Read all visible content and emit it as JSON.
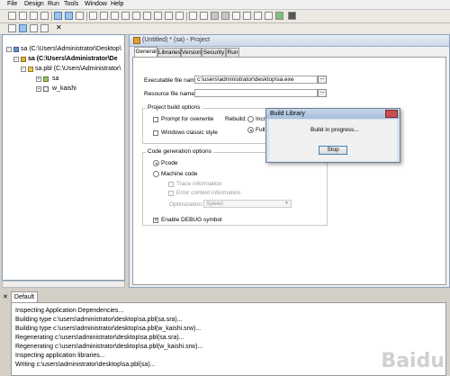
{
  "menu": [
    "File",
    "Design",
    "Run",
    "Tools",
    "Window",
    "Help"
  ],
  "tree": {
    "workspace": "sa (C:\\Users\\Administrator\\Desktop\\",
    "target": "sa (C:\\Users\\Administrator\\De",
    "library": "sa.pbl (C:\\Users\\Administrator\\",
    "item1": "sa",
    "item2": "w_kaishi"
  },
  "project": {
    "title": "(Untitled) * (sa) - Project",
    "tabs": [
      "General",
      "Libraries",
      "Version",
      "Security",
      "Run"
    ],
    "exe_label": "Executable file name:",
    "exe_value": "c:\\users\\administrator\\desktop\\sa.exe",
    "res_label": "Resource file name:",
    "res_value": "",
    "dots": "...",
    "build_options_title": "Project build options",
    "prompt_overwrite": "Prompt for overwrite",
    "rebuild_label": "Rebuild:",
    "rebuild_incr": "Incre",
    "rebuild_full": "Full",
    "classic_style": "Windows classic style",
    "codegen_title": "Code generation options",
    "pcode": "Pcode",
    "machine_code": "Machine code",
    "trace_info": "Trace information",
    "error_context": "Error context information",
    "optimization_label": "Optimization:",
    "optimization_value": "Speed",
    "debug_symbol": "Enable DEBUG symbol"
  },
  "dialog": {
    "title": "Build Library",
    "message": "Build in progress...",
    "stop": "Stop"
  },
  "output": {
    "tab": "Default",
    "close": "✕",
    "lines": [
      "Inspecting Application Dependencies...",
      "Building type c:\\users\\administrator\\desktop\\sa.pbl(sa.sra)...",
      "Building type c:\\users\\administrator\\desktop\\sa.pbl(w_kaishi.srw)...",
      "Regenerating c:\\users\\administrator\\desktop\\sa.pbl(sa.sra)...",
      "Regenerating c:\\users\\administrator\\desktop\\sa.pbl(w_kaishi.srw)...",
      "Inspecting application libraries...",
      "Writing c:\\users\\administrator\\desktop\\sa.pbl(sa)..."
    ]
  },
  "watermark": "Baidu"
}
